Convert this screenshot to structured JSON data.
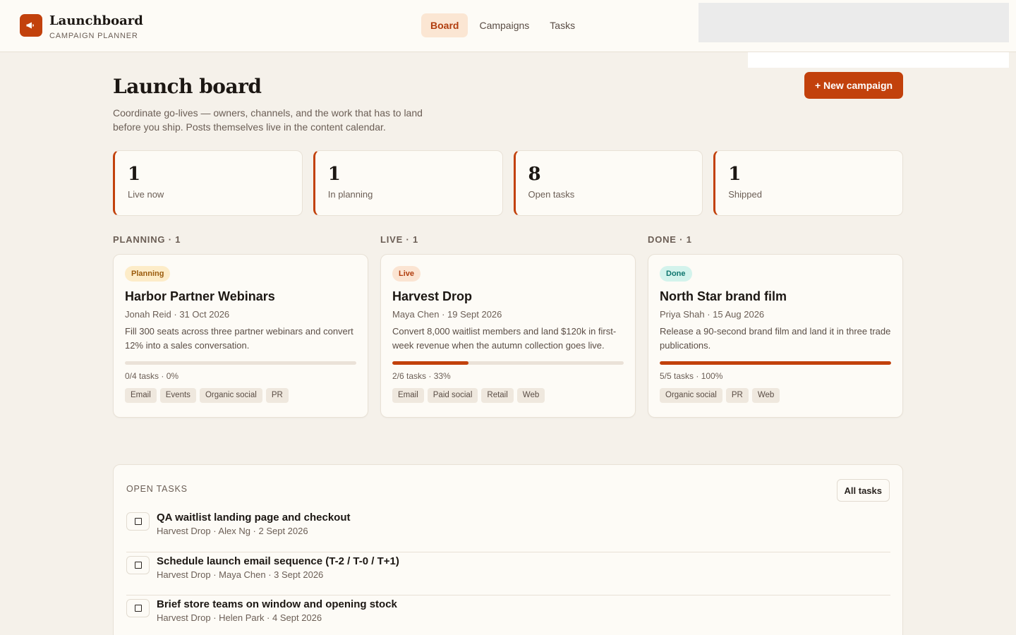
{
  "brand": {
    "name": "Launchboard",
    "subtitle": "CAMPAIGN PLANNER",
    "logo_icon": "megaphone-icon"
  },
  "nav": {
    "items": [
      {
        "label": "Board",
        "active": true
      },
      {
        "label": "Campaigns",
        "active": false
      },
      {
        "label": "Tasks",
        "active": false
      }
    ]
  },
  "hero": {
    "title": "Launch board",
    "description": "Coordinate go-lives — owners, channels, and the work that has to land before you ship. Posts themselves live in the content calendar.",
    "new_button": "+ New campaign"
  },
  "stats": [
    {
      "value": "1",
      "label": "Live now"
    },
    {
      "value": "1",
      "label": "In planning"
    },
    {
      "value": "8",
      "label": "Open tasks"
    },
    {
      "value": "1",
      "label": "Shipped"
    }
  ],
  "columns": [
    {
      "heading": "PLANNING · 1",
      "card": {
        "status": "Planning",
        "title": "Harbor Partner Webinars",
        "meta": "Jonah Reid · 31 Oct 2026",
        "description": "Fill 300 seats across three partner webinars and convert 12% into a sales conversation.",
        "progress": 0,
        "progress_text": "0/4 tasks · 0%",
        "channels": [
          "Email",
          "Events",
          "Organic social",
          "PR"
        ]
      }
    },
    {
      "heading": "LIVE · 1",
      "card": {
        "status": "Live",
        "title": "Harvest Drop",
        "meta": "Maya Chen · 19 Sept 2026",
        "description": "Convert 8,000 waitlist members and land $120k in first-week revenue when the autumn collection goes live.",
        "progress": 33,
        "progress_text": "2/6 tasks · 33%",
        "channels": [
          "Email",
          "Paid social",
          "Retail",
          "Web"
        ]
      }
    },
    {
      "heading": "DONE · 1",
      "card": {
        "status": "Done",
        "title": "North Star brand film",
        "meta": "Priya Shah · 15 Aug 2026",
        "description": "Release a 90-second brand film and land it in three trade publications.",
        "progress": 100,
        "progress_text": "5/5 tasks · 100%",
        "channels": [
          "Organic social",
          "PR",
          "Web"
        ]
      }
    }
  ],
  "tasks": {
    "title": "OPEN TASKS",
    "all_button": "All tasks",
    "items": [
      {
        "title": "QA waitlist landing page and checkout",
        "meta": "Harvest Drop · Alex Ng · 2 Sept 2026"
      },
      {
        "title": "Schedule launch email sequence (T-2 / T-0 / T+1)",
        "meta": "Harvest Drop · Maya Chen · 3 Sept 2026"
      },
      {
        "title": "Brief store teams on window and opening stock",
        "meta": "Harvest Drop · Helen Park · 4 Sept 2026"
      }
    ]
  },
  "colors": {
    "accent": "#c2410c",
    "background": "#f5f1ea",
    "surface": "#fdfbf6"
  }
}
